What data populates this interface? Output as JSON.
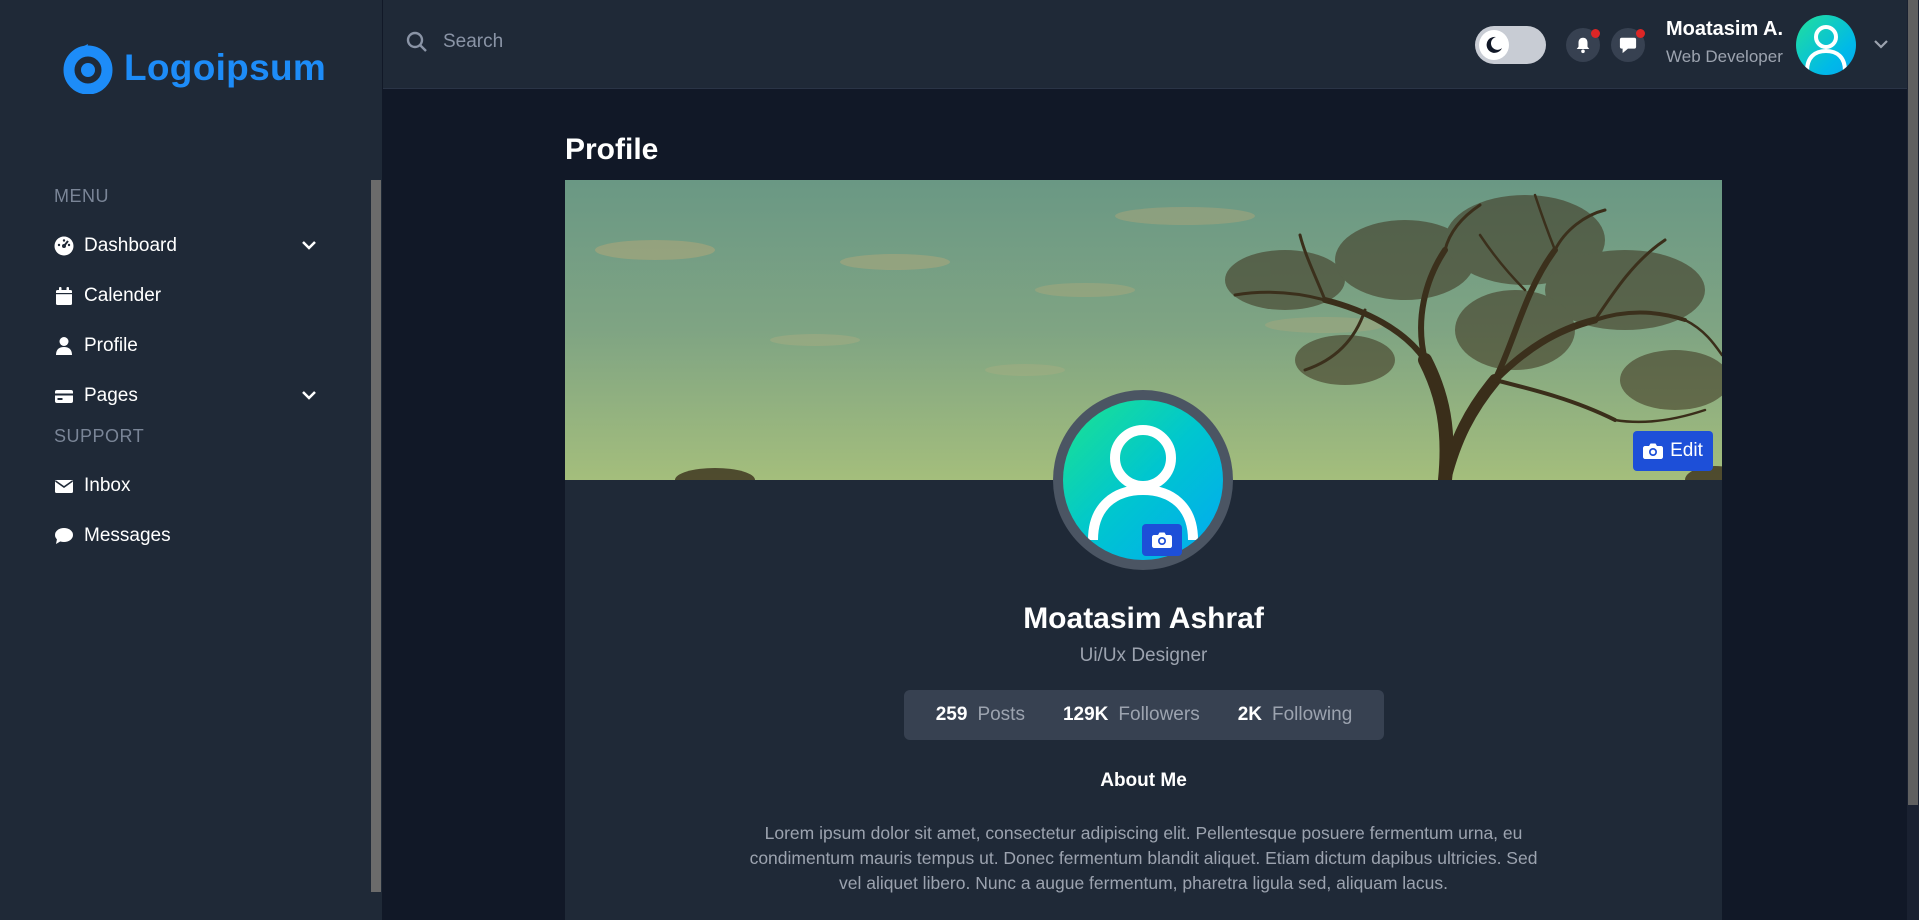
{
  "brand": {
    "name": "Logoipsum",
    "color": "#1d8cf8"
  },
  "sidebar": {
    "menu_title": "MENU",
    "support_title": "SUPPORT",
    "menu_items": [
      {
        "label": "Dashboard",
        "icon": "dashboard-gauge-icon",
        "has_dropdown": true
      },
      {
        "label": "Calender",
        "icon": "calendar-icon",
        "has_dropdown": false
      },
      {
        "label": "Profile",
        "icon": "user-icon",
        "has_dropdown": false
      },
      {
        "label": "Pages",
        "icon": "pages-card-icon",
        "has_dropdown": true
      }
    ],
    "support_items": [
      {
        "label": "Inbox",
        "icon": "envelope-icon"
      },
      {
        "label": "Messages",
        "icon": "chat-bubble-icon"
      }
    ]
  },
  "header": {
    "search_placeholder": "Search",
    "theme_toggle": {
      "mode": "dark",
      "icon": "moon-icon"
    },
    "notifications": {
      "icon": "bell-icon",
      "has_unread": true
    },
    "messages": {
      "icon": "message-icon",
      "has_unread": true
    },
    "user": {
      "name": "Moatasim A.",
      "role": "Web Developer"
    }
  },
  "page": {
    "title": "Profile",
    "cover_edit_label": "Edit",
    "profile": {
      "name": "Moatasim Ashraf",
      "role": "Ui/Ux Designer",
      "stats": [
        {
          "value": "259",
          "label": "Posts"
        },
        {
          "value": "129K",
          "label": "Followers"
        },
        {
          "value": "2K",
          "label": "Following"
        }
      ],
      "about_title": "About Me",
      "about_text": "Lorem ipsum dolor sit amet, consectetur adipiscing elit. Pellentesque posuere fermentum urna, eu condimentum mauris tempus ut. Donec fermentum blandit aliquet. Etiam dictum dapibus ultricies. Sed vel aliquet libero. Nunc a augue fermentum, pharetra ligula sed, aliquam lacus."
    }
  },
  "colors": {
    "sidebar_bg": "#1f2937",
    "page_bg": "#111827",
    "accent_blue": "#1d4fd8",
    "avatar_gradient_start": "#1de38e",
    "avatar_gradient_end": "#02a9f2",
    "badge_red": "#dc2626"
  }
}
